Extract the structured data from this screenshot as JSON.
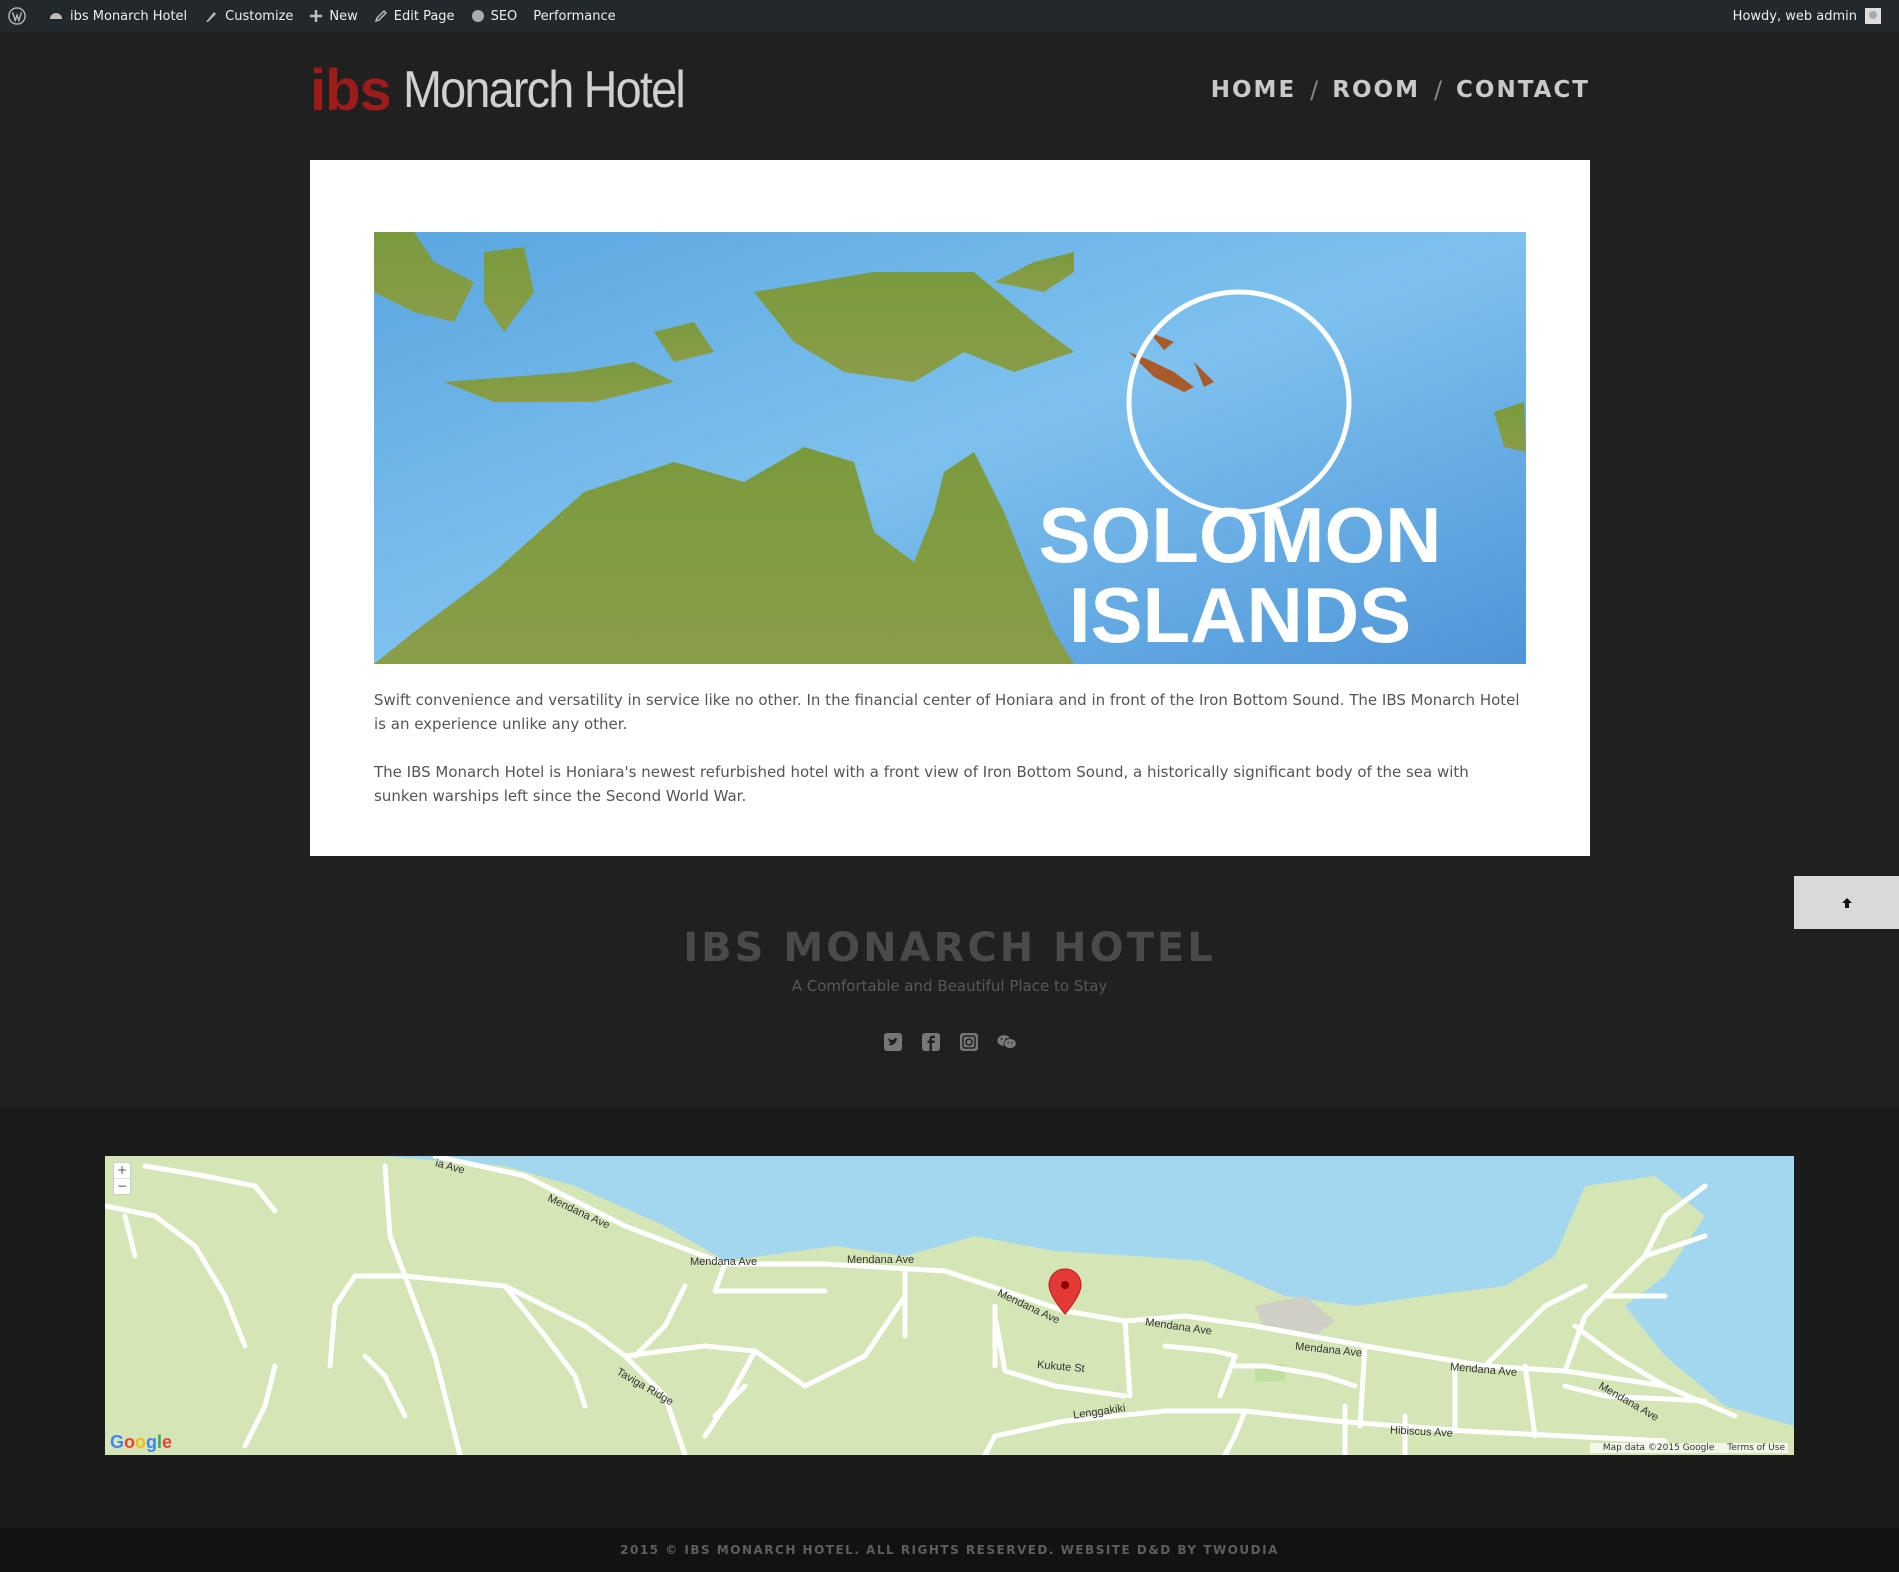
{
  "admin_bar": {
    "site_name": "ibs Monarch Hotel",
    "customize": "Customize",
    "new": "New",
    "edit_page": "Edit Page",
    "seo": "SEO",
    "performance": "Performance",
    "greeting": "Howdy, web admin"
  },
  "header": {
    "logo_accent": "ibs",
    "logo_name": "Monarch Hotel",
    "nav": [
      "HOME",
      "ROOM",
      "CONTACT"
    ],
    "nav_separator": "/"
  },
  "content": {
    "hero_line1": "SOLOMON",
    "hero_line2": "ISLANDS",
    "paragraph1": "Swift convenience and versatility in service like no other. In the financial center of Honiara and in front of the Iron Bottom Sound. The IBS Monarch Hotel is an experience unlike any other.",
    "paragraph2": "The IBS Monarch Hotel is Honiara's newest refurbished hotel with a front view of Iron Bottom Sound, a historically significant body of the sea with sunken warships left since the Second World War."
  },
  "footer_brand": {
    "title": "IBS MONARCH HOTEL",
    "tagline": "A Comfortable and Beautiful Place to Stay",
    "social_icons": [
      "twitter-icon",
      "facebook-icon",
      "instagram-icon",
      "wechat-icon"
    ]
  },
  "map": {
    "zoom_in": "+",
    "zoom_out": "−",
    "logo_text": "Google",
    "map_data": "Map data ©2015 Google",
    "terms": "Terms of Use",
    "road_labels": [
      "ia Ave",
      "Mendana Ave",
      "Mendana Ave",
      "Mendana Ave",
      "Mendana Ave",
      "Mendana Ave",
      "Mendana Ave",
      "Mendana Ave",
      "Mendana Ave",
      "Taviga Ridge",
      "Kukute St",
      "Lenggakiki",
      "Hibiscus Ave"
    ]
  },
  "copyright": "2015 © IBS MONARCH HOTEL. ALL RIGHTS RESERVED. WEBSITE D&D BY TWOUDIA",
  "colors": {
    "page_bg": "#202020",
    "admin_bar_bg": "#23282d",
    "logo_red": "#9e1b1b",
    "map_land": "#d4e5b6",
    "map_water": "#a3d7f0",
    "marker": "#e53935"
  }
}
